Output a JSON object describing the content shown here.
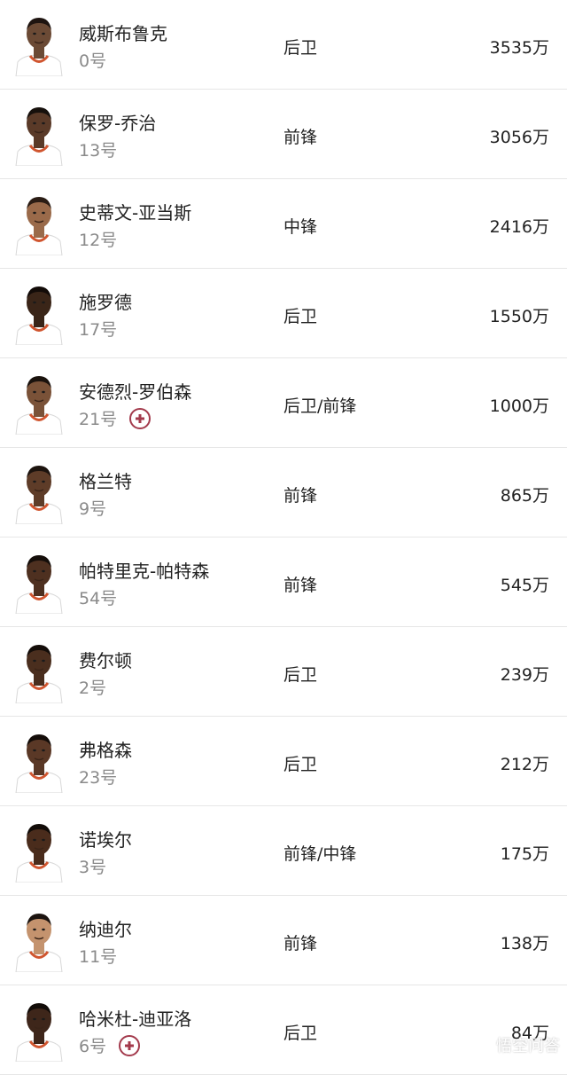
{
  "players": [
    {
      "name": "威斯布鲁克",
      "number": "0号",
      "position": "后卫",
      "salary": "3535万",
      "injured": false,
      "skin": "#6b4a35",
      "hair": "#1e1410"
    },
    {
      "name": "保罗-乔治",
      "number": "13号",
      "position": "前锋",
      "salary": "3056万",
      "injured": false,
      "skin": "#5a3a28",
      "hair": "#16100c"
    },
    {
      "name": "史蒂文-亚当斯",
      "number": "12号",
      "position": "中锋",
      "salary": "2416万",
      "injured": false,
      "skin": "#9a6a4a",
      "hair": "#2a1c14"
    },
    {
      "name": "施罗德",
      "number": "17号",
      "position": "后卫",
      "salary": "1550万",
      "injured": false,
      "skin": "#3a2518",
      "hair": "#120b08"
    },
    {
      "name": "安德烈-罗伯森",
      "number": "21号",
      "position": "后卫/前锋",
      "salary": "1000万",
      "injured": true,
      "skin": "#7a5238",
      "hair": "#1a120d"
    },
    {
      "name": "格兰特",
      "number": "9号",
      "position": "前锋",
      "salary": "865万",
      "injured": false,
      "skin": "#5e3c28",
      "hair": "#1c130e"
    },
    {
      "name": "帕特里克-帕特森",
      "number": "54号",
      "position": "前锋",
      "salary": "545万",
      "injured": false,
      "skin": "#4e3020",
      "hair": "#150e0a"
    },
    {
      "name": "费尔顿",
      "number": "2号",
      "position": "后卫",
      "salary": "239万",
      "injured": false,
      "skin": "#4a2e1e",
      "hair": "#140d09"
    },
    {
      "name": "弗格森",
      "number": "23号",
      "position": "后卫",
      "salary": "212万",
      "injured": false,
      "skin": "#5a3826",
      "hair": "#140d09"
    },
    {
      "name": "诺埃尔",
      "number": "3号",
      "position": "前锋/中锋",
      "salary": "175万",
      "injured": false,
      "skin": "#4a2c1c",
      "hair": "#120c08"
    },
    {
      "name": "纳迪尔",
      "number": "11号",
      "position": "前锋",
      "salary": "138万",
      "injured": false,
      "skin": "#c4936e",
      "hair": "#1c1410"
    },
    {
      "name": "哈米杜-迪亚洛",
      "number": "6号",
      "position": "后卫",
      "salary": "84万",
      "injured": true,
      "skin": "#3e261a",
      "hair": "#120c08"
    }
  ],
  "watermark": {
    "text": "悟空问答"
  },
  "colors": {
    "jersey": "#ffffff",
    "jersey_trim": "#d0552f",
    "injury_badge": "#a33a4c",
    "divider": "#e6e6e6",
    "secondary_text": "#8a8a8a"
  }
}
